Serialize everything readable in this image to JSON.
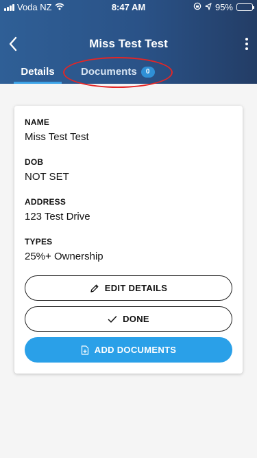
{
  "status_bar": {
    "carrier": "Voda NZ",
    "time": "8:47 AM",
    "battery_percent": "95%",
    "battery_level": 0.95,
    "icons": [
      "signal-icon",
      "wifi-icon",
      "lock-rotation-icon",
      "location-icon",
      "battery-icon"
    ]
  },
  "header": {
    "title": "Miss Test Test",
    "back_icon": "chevron-left-icon",
    "more_icon": "more-vertical-icon",
    "tabs": [
      {
        "label": "Details",
        "active": true
      },
      {
        "label": "Documents",
        "badge": "0",
        "active": false
      }
    ],
    "annotation_color": "#e32626"
  },
  "card": {
    "fields": [
      {
        "label": "NAME",
        "value": "Miss Test Test"
      },
      {
        "label": "DOB",
        "value": "NOT SET"
      },
      {
        "label": "ADDRESS",
        "value": "123 Test Drive"
      },
      {
        "label": "TYPES",
        "value": "25%+ Ownership"
      }
    ],
    "buttons": {
      "edit": {
        "label": "EDIT DETAILS",
        "icon": "pencil-icon"
      },
      "done": {
        "label": "DONE",
        "icon": "check-icon"
      },
      "add_documents": {
        "label": "ADD DOCUMENTS",
        "icon": "document-add-icon"
      }
    }
  },
  "colors": {
    "header_start": "#2f5f96",
    "header_end": "#233d66",
    "accent": "#2aa0e8",
    "badge": "#2f90d6",
    "background": "#f5f5f5"
  }
}
